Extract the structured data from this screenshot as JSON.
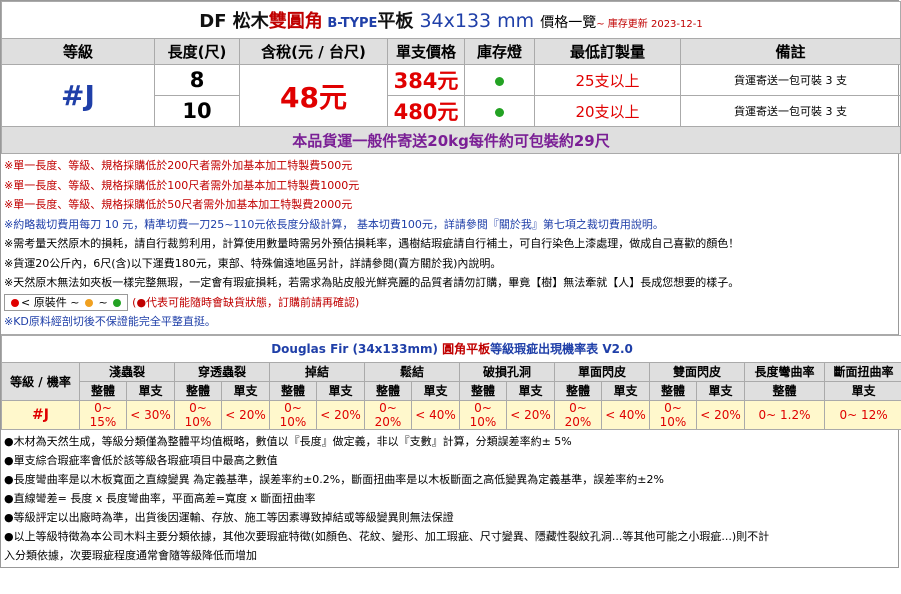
{
  "title": {
    "prefix": "DF 松木",
    "highlight": "雙圓角",
    "btype": " B-TYPE",
    "board": "平板",
    "size": " 34x133 mm ",
    "list": "價格一覽",
    "update": "~ 庫存更新 2023-12-1"
  },
  "headers": [
    "等級",
    "長度(尺)",
    "含稅(元 / 台尺)",
    "單支價格",
    "庫存燈",
    "最低訂製量",
    "備註"
  ],
  "grade": "#J",
  "price_per_unit": "48元",
  "rows": [
    {
      "length": "8",
      "unit_price": "384元",
      "min_qty": "25支以上",
      "note": "貨運寄送一包可裝 3 支"
    },
    {
      "length": "10",
      "unit_price": "480元",
      "min_qty": "20支以上",
      "note": "貨運寄送一包可裝 3 支"
    }
  ],
  "shipping": "本品貨運一般件寄送20kg每件約可包裝約29尺",
  "notes": [
    "※單一長度、等級、規格採購低於200尺者需外加基本加工特製費500元",
    "※單一長度、等級、規格採購低於100尺者需外加基本加工特製費1000元",
    "※單一長度、等級、規格採購低於50尺者需外加基本加工特製費2000元",
    "※約略裁切費用每刀 10 元，精準切費一刀25~110元依長度分級計算， 基本切費100元，詳請參閱『關於我』第七項之裁切費用說明。",
    "※需考量天然原木的損耗，請自行裁剪利用，計算使用數量時需另外預估損耗率，遇樹結瑕疵請自行補土，可自行染色上漆處理，做成自己喜歡的顏色！",
    "※貨運20公斤內，6尺(含)以下運費180元，東部、特殊偏遠地區另計，詳請參閱(賣方關於我)內說明。",
    "※天然原木無法如夾板一樣完整無瑕，一定會有瑕疵損耗，若需求為貼皮般光鮮亮麗的品質者請勿訂購，畢竟【樹】無法牽就【人】長成您想要的樣子。"
  ],
  "legend": {
    "label": "< 原裝件",
    "sep": "~",
    "dot_colors": [
      "#e00000",
      "#f0a020",
      "#23a223"
    ],
    "warning": "(●代表可能隨時會缺貨狀態，訂購前請再確認)"
  },
  "kd_note": "※KD原料經剖切後不保證能完全平整直挺。",
  "defect_table": {
    "title_en": "Douglas Fir (34x133mm)",
    "title_zh": " 圓角平板",
    "title_rest": "等級瑕疵出現機率表 V2.0",
    "grade_header": "等級 / 機率",
    "categories": [
      "淺蟲裂",
      "穿透蟲裂",
      "掉結",
      "鬆結",
      "破損孔洞",
      "單面閃皮",
      "雙面閃皮",
      "長度彎曲率",
      "斷面扭曲率"
    ],
    "sub_whole": "整體",
    "sub_single": "單支",
    "row_grade": "#J",
    "values": [
      "0~ 15%",
      "< 30%",
      "0~ 10%",
      "< 20%",
      "0~ 10%",
      "< 20%",
      "0~ 20%",
      "< 40%",
      "0~ 10%",
      "< 20%",
      "0~ 20%",
      "< 40%",
      "0~ 10%",
      "< 20%",
      "0~ 1.2%",
      "0~ 12%"
    ]
  },
  "bottom_notes": [
    "●木材為天然生成，等級分類僅為整體平均值概略，數值以『長度』做定義，非以『支數』計算，分類誤差率約± 5%",
    "●單支綜合瑕疵率會低於該等級各瑕疵項目中最高之數值",
    "●長度彎曲率是以木板寬面之直線變異 為定義基準，誤差率約±0.2%，斷面扭曲率是以木板斷面之高低變異為定義基準，誤差率約±2%",
    "●直線彎差= 長度 x 長度彎曲率，平面高差=寬度 x 斷面扭曲率",
    "●等級評定以出廠時為準，出貨後因運輸、存放、施工等因素導致掉結或等級變異則無法保證",
    "●以上等級特徵為本公司木料主要分類依據，其他次要瑕疵特徵(如顏色、花紋、變形、加工瑕疵、尺寸變異、隱藏性裂紋孔洞...等其他可能之小瑕疵...)則不計",
    "入分類依據，次要瑕疵程度通常會隨等級降低而增加"
  ]
}
